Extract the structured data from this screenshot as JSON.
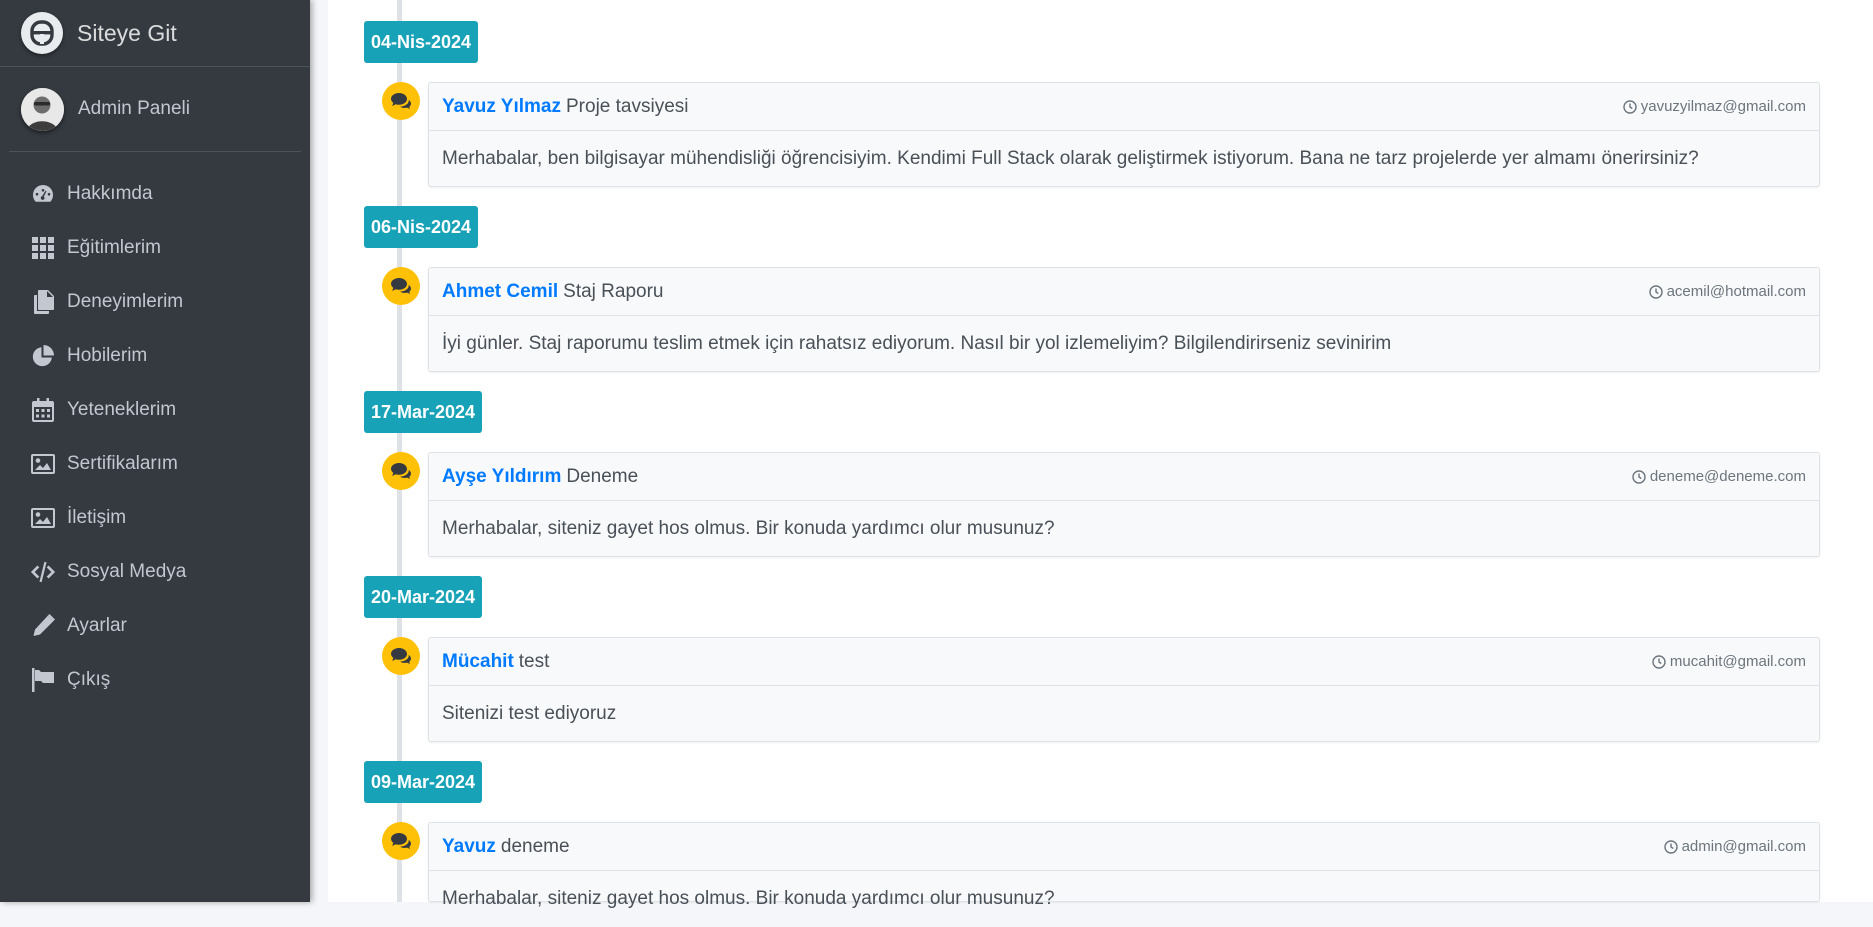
{
  "brand": {
    "title": "Siteye Git"
  },
  "user": {
    "name": "Admin Paneli"
  },
  "sidebar": {
    "items": [
      {
        "label": "Hakkımda",
        "icon": "gauge-icon"
      },
      {
        "label": "Eğitimlerim",
        "icon": "grid-icon"
      },
      {
        "label": "Deneyimlerim",
        "icon": "copy-icon"
      },
      {
        "label": "Hobilerim",
        "icon": "pie-chart-icon"
      },
      {
        "label": "Yeteneklerim",
        "icon": "calendar-icon"
      },
      {
        "label": "Sertifikalarım",
        "icon": "image-icon"
      },
      {
        "label": "İletişim",
        "icon": "image-icon"
      },
      {
        "label": "Sosyal Medya",
        "icon": "code-icon"
      },
      {
        "label": "Ayarlar",
        "icon": "pencil-icon"
      },
      {
        "label": "Çıkış",
        "icon": "flag-icon"
      }
    ]
  },
  "timeline": [
    {
      "date": "04-Nis-2024",
      "name": "Yavuz Yılmaz",
      "subject": "Proje tavsiyesi",
      "email": "yavuzyilmaz@gmail.com",
      "message": "Merhabalar, ben bilgisayar mühendisliği öğrencisiyim. Kendimi Full Stack olarak geliştirmek istiyorum. Bana ne tarz projelerde yer almamı önerirsiniz?"
    },
    {
      "date": "06-Nis-2024",
      "name": "Ahmet Cemil",
      "subject": "Staj Raporu",
      "email": "acemil@hotmail.com",
      "message": "İyi günler. Staj raporumu teslim etmek için rahatsız ediyorum. Nasıl bir yol izlemeliyim? Bilgilendirirseniz sevinirim"
    },
    {
      "date": "17-Mar-2024",
      "name": "Ayşe Yıldırım",
      "subject": "Deneme",
      "email": "deneme@deneme.com",
      "message": "Merhabalar, siteniz gayet hos olmus. Bir konuda yardımcı olur musunuz?"
    },
    {
      "date": "20-Mar-2024",
      "name": "Mücahit",
      "subject": "test",
      "email": "mucahit@gmail.com",
      "message": "Sitenizi test ediyoruz"
    },
    {
      "date": "09-Mar-2024",
      "name": "Yavuz",
      "subject": "deneme",
      "email": "admin@gmail.com",
      "message": "Merhabalar, siteniz gayet hos olmus. Bir konuda yardımcı olur musunuz?"
    }
  ],
  "colors": {
    "sidebar_bg": "#343a40",
    "date_badge": "#17a2b8",
    "icon_bubble": "#ffc107",
    "link": "#007bff"
  }
}
